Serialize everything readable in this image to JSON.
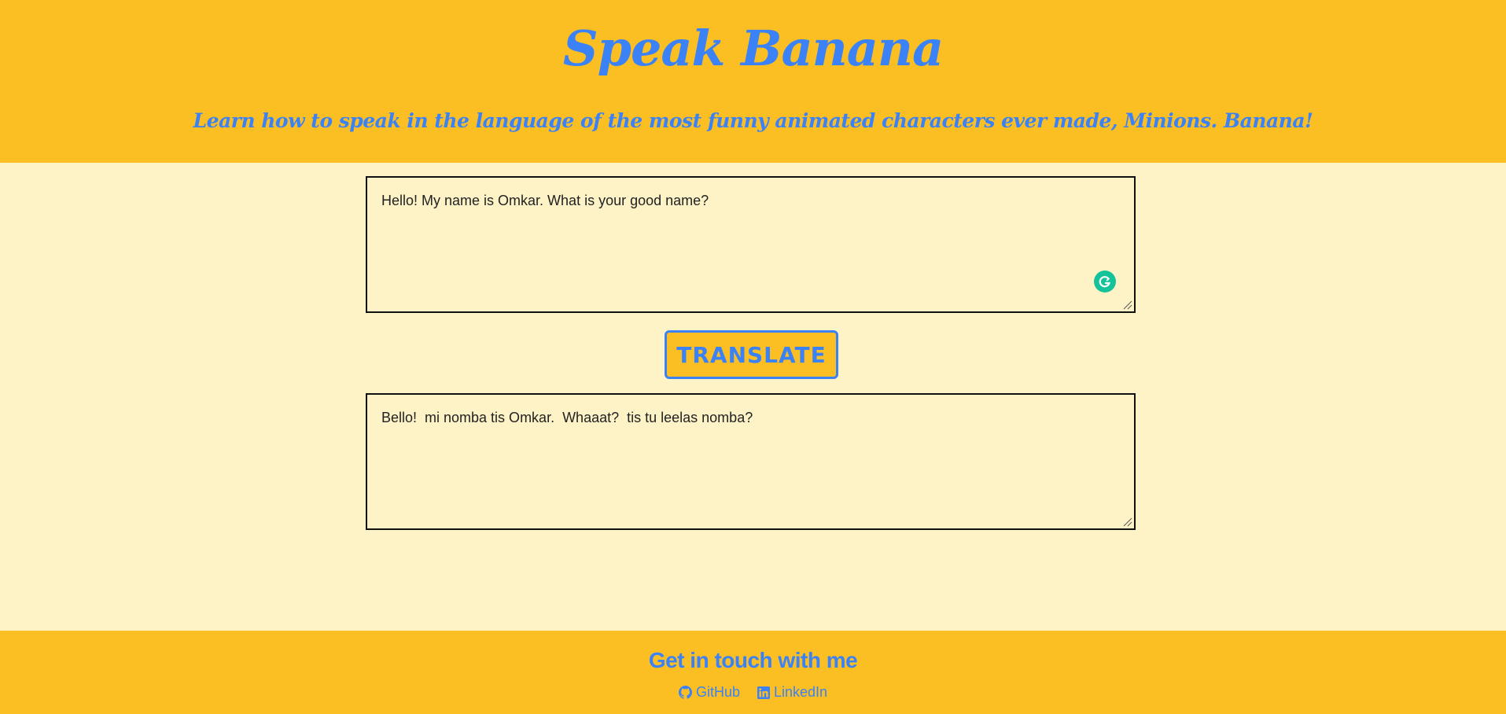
{
  "header": {
    "title": "Speak Banana",
    "subtitle": "Learn how to speak in the language of the most funny animated characters ever made, Minions. Banana!"
  },
  "input": {
    "value": "Hello! My name is Omkar. What is your good name?"
  },
  "translate_button": {
    "label": "TRANSLATE"
  },
  "output": {
    "value": "Bello!  mi nomba tis Omkar.  Whaaat?  tis tu leelas nomba?"
  },
  "footer": {
    "title": "Get in touch with me",
    "links": [
      {
        "label": "GitHub",
        "icon": "github-icon"
      },
      {
        "label": "LinkedIn",
        "icon": "linkedin-icon"
      }
    ]
  },
  "colors": {
    "brand_yellow": "#fbbf24",
    "background": "#fef3c7",
    "accent_blue": "#3b82f6",
    "grammarly_green": "#15c39a"
  }
}
